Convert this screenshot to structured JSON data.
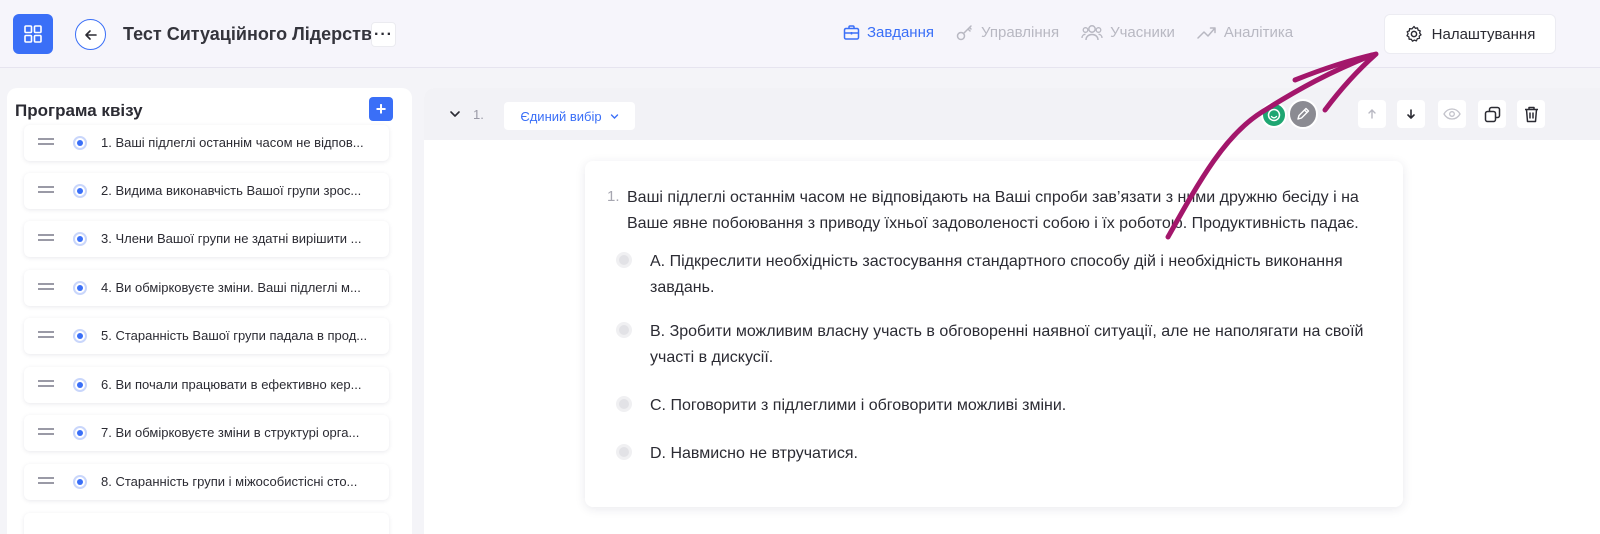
{
  "header": {
    "title": "Тест Ситуаційного Лідерства",
    "more_label": "···",
    "nav": [
      {
        "label": "Завдання",
        "icon": "briefcase-icon",
        "active": true
      },
      {
        "label": "Управління",
        "icon": "key-icon",
        "active": false
      },
      {
        "label": "Учасники",
        "icon": "users-icon",
        "active": false
      },
      {
        "label": "Аналітика",
        "icon": "trend-icon",
        "active": false
      }
    ],
    "settings_label": "Налаштування"
  },
  "sidebar": {
    "title": "Програма квізу",
    "add_label": "+",
    "items": [
      {
        "label": "1. Ваші підлеглі останнім часом не відпов..."
      },
      {
        "label": "2. Видима виконавчість Вашої групи зрос..."
      },
      {
        "label": "3. Члени Вашої групи не здатні вирішити ..."
      },
      {
        "label": "4. Ви обмірковуєте зміни. Ваші підлеглі м..."
      },
      {
        "label": "5. Старанність Вашої групи падала в прод..."
      },
      {
        "label": "6. Ви почали працювати в ефективно кер..."
      },
      {
        "label": "7. Ви обмірковуєте зміни в структурі орга..."
      },
      {
        "label": "8. Старанність групи і міжособистісні сто..."
      }
    ]
  },
  "question": {
    "header_number": "1.",
    "type_label": "Єдиний вибір",
    "number": "1.",
    "text": "Ваші підлеглі останнім часом не відповідають на Ваші спроби зав’язати  з ними  дружню бесіду і на Ваше явне побоювання з приводу їхньої задоволеності собою і їх роботою. Продуктивність падає.",
    "answers": [
      {
        "label": "A. Підкреслити необхідність застосування стандартного способу дій і необхідність виконання завдань."
      },
      {
        "label": "B. Зробити можливим власну участь в обговоренні наявної ситуації, але не наполягати на своїй участі в дискусії."
      },
      {
        "label": "C. Поговорити з підлеглими і обговорити можливі зміни."
      },
      {
        "label": "D. Навмисно не втручатися."
      }
    ]
  },
  "colors": {
    "accent": "#3a6ff7",
    "annotation_arrow": "#a3166b",
    "avatar_green": "#1ea672"
  }
}
